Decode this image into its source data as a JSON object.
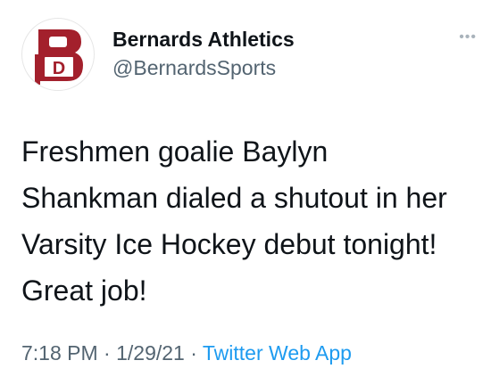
{
  "account": {
    "display_name": "Bernards Athletics",
    "handle": "@BernardsSports",
    "avatar_letters": "B",
    "avatar_sub_letter": "D"
  },
  "more_icon": "more-horizontal-icon",
  "tweet": {
    "text": "Freshmen goalie Baylyn Shankman dialed a shutout in her Varsity Ice Hockey debut tonight! Great job!"
  },
  "meta": {
    "time": "7:18 PM",
    "separator": "·",
    "date": "1/29/21",
    "source": "Twitter Web App"
  },
  "colors": {
    "brand_red": "#a3202c",
    "link_blue": "#1d9bf0",
    "secondary_text": "#536471"
  }
}
